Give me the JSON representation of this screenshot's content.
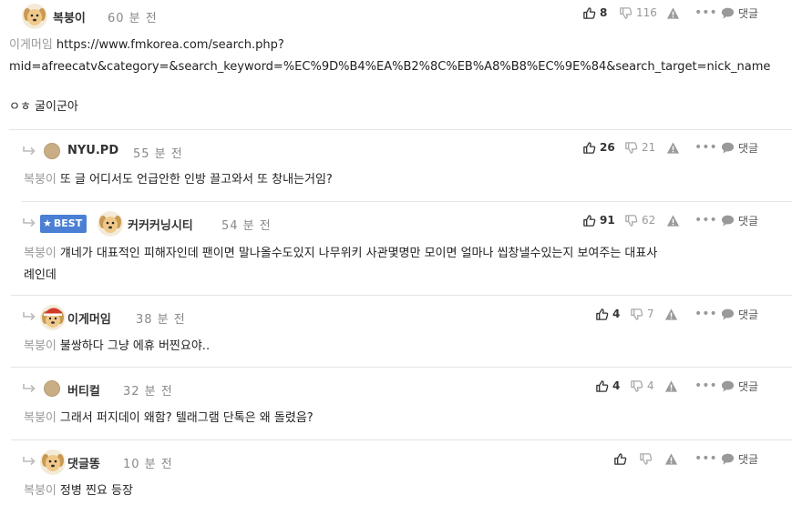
{
  "actions_labels": {
    "reply": "댓글"
  },
  "colors": {
    "best_badge": "#4a7fd4",
    "divider": "#e4e4e4",
    "muted": "#999999"
  },
  "comments": [
    {
      "nick": "복붕이",
      "time": "60 분 전",
      "avatar": "puppy-avatar",
      "upvotes": "8",
      "downvotes": "116",
      "line1_mention": "이게머임",
      "line1": "https://www.fmkorea.com/search.php?",
      "line2": "mid=afreecatv&category=&search_keyword=%EC%9D%B4%EA%B2%8C%EB%A8%B8%EC%9E%84&search_target=nick_name",
      "line3": "ㅇㅎ 굴이군아"
    },
    {
      "nick": "NYU.PD",
      "time": "55 분 전",
      "avatar": "circle-avatar",
      "upvotes": "26",
      "downvotes": "21",
      "mention": "복붕이",
      "text": "또 글 어디서도 언급안한 인방 끌고와서 또 창내는거임?"
    },
    {
      "badge": "BEST",
      "nick": "커커커닝시티",
      "time": "54 분 전",
      "avatar": "puppy-avatar",
      "upvotes": "91",
      "downvotes": "62",
      "mention": "복붕이",
      "text": "걔네가 대표적인 피해자인데 팬이면 말나올수도있지 나무위키 사관몇명만 모이면 얼마나 씹창낼수있는지 보여주는 대표사",
      "text2": "례인데"
    },
    {
      "nick": "이게머임",
      "time": "38 분 전",
      "avatar": "santa-puppy-avatar",
      "upvotes": "4",
      "downvotes": "7",
      "mention": "복붕이",
      "text": "불쌍하다 그냥 에휴 버찐요야.."
    },
    {
      "nick": "버티컬",
      "time": "32 분 전",
      "avatar": "circle-avatar",
      "upvotes": "4",
      "downvotes": "4",
      "mention": "복붕이",
      "text": "그래서 퍼지데이 왜함? 텔래그램 단톡은 왜 돌렸음?"
    },
    {
      "nick": "댓글똥",
      "time": "10 분 전",
      "avatar": "puppy-avatar",
      "upvotes": "",
      "downvotes": "",
      "mention": "복붕이",
      "text": "정병 찐요 등장"
    }
  ]
}
